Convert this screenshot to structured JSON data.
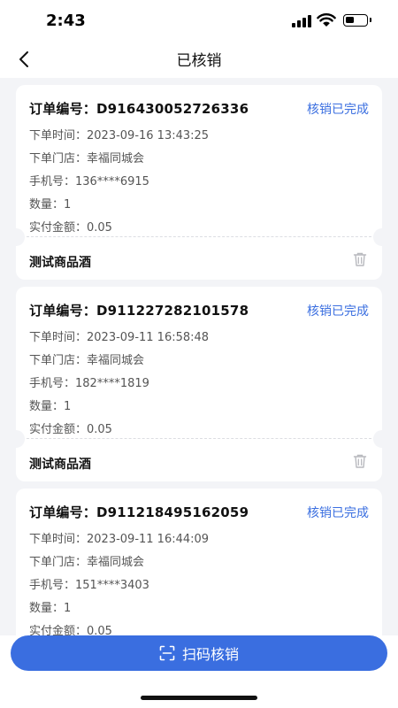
{
  "status_bar": {
    "time": "2:43"
  },
  "nav": {
    "title": "已核销"
  },
  "orders": [
    {
      "order_no": "订单编号：D916430052726336",
      "status": "核销已完成",
      "order_time": "下单时间：2023-09-16 13:43:25",
      "store": "下单门店：幸福同城会",
      "phone": "手机号：136****6915",
      "quantity": "数量：1",
      "paid": "实付金额：0.05",
      "product": "测试商品酒"
    },
    {
      "order_no": "订单编号：D911227282101578",
      "status": "核销已完成",
      "order_time": "下单时间：2023-09-11 16:58:48",
      "store": "下单门店：幸福同城会",
      "phone": "手机号：182****1819",
      "quantity": "数量：1",
      "paid": "实付金额：0.05",
      "product": "测试商品酒"
    },
    {
      "order_no": "订单编号：D911218495162059",
      "status": "核销已完成",
      "order_time": "下单时间：2023-09-11 16:44:09",
      "store": "下单门店：幸福同城会",
      "phone": "手机号：151****3403",
      "quantity": "数量：1",
      "paid": "实付金额：0.05",
      "product": ""
    }
  ],
  "actions": {
    "scan_label": "扫码核销"
  },
  "colors": {
    "accent": "#3a6ee0",
    "status_text": "#3b6fe0",
    "background": "#f3f4f7"
  }
}
